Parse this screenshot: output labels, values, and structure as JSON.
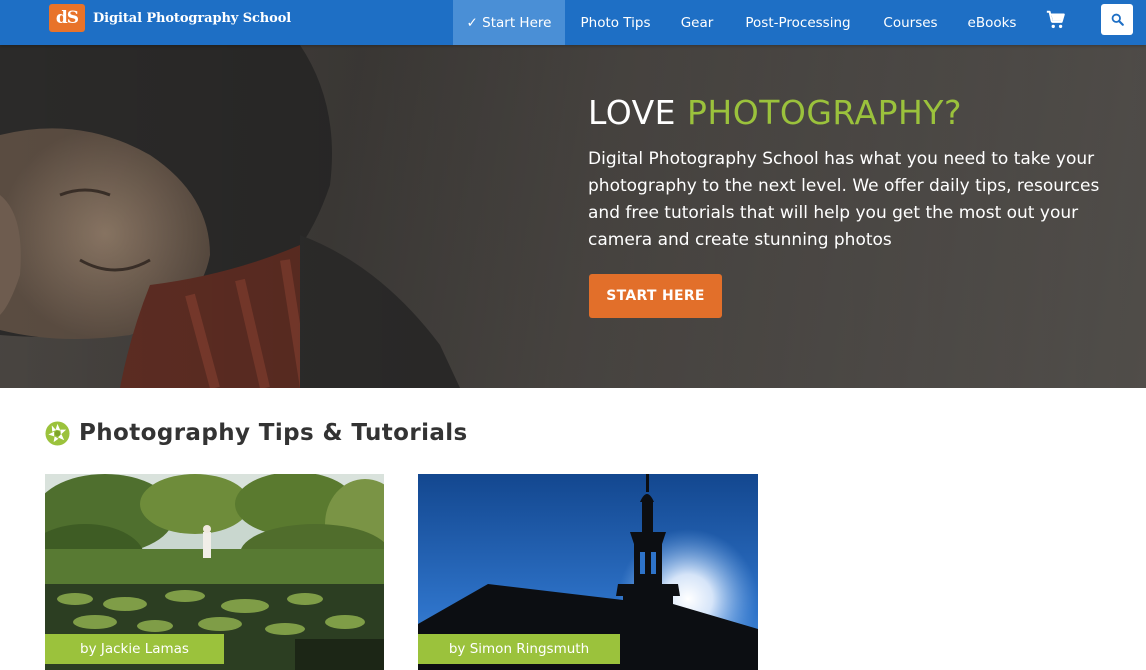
{
  "header": {
    "logo_mark": "dS",
    "logo_text": "Digital Photography School",
    "nav": [
      {
        "label": "✓ Start Here",
        "active": true
      },
      {
        "label": "Photo Tips",
        "active": false
      },
      {
        "label": "Gear",
        "active": false
      },
      {
        "label": "Post-Processing",
        "active": false
      },
      {
        "label": "Courses",
        "active": false
      },
      {
        "label": "eBooks",
        "active": false
      }
    ],
    "cart_icon": "shopping-cart-icon",
    "search_icon": "search-icon"
  },
  "hero": {
    "title_plain": "LOVE ",
    "title_accent": "PHOTOGRAPHY?",
    "text": "Digital Photography School has what you need to take your photography to the next level. We offer daily tips, resources and free tutorials that will help you get the most out your camera and create stunning photos",
    "cta": "START HERE"
  },
  "section": {
    "title": "Photography Tips & Tutorials",
    "icon": "aperture-icon"
  },
  "articles": [
    {
      "byline": "by Jackie Lamas"
    },
    {
      "byline": "by Simon Ringsmuth"
    }
  ],
  "colors": {
    "nav_blue": "#1e6fc5",
    "nav_active": "#4a8fd6",
    "accent_green": "#9bc23c",
    "cta_orange": "#e26f2a",
    "logo_orange": "#e8732a"
  }
}
